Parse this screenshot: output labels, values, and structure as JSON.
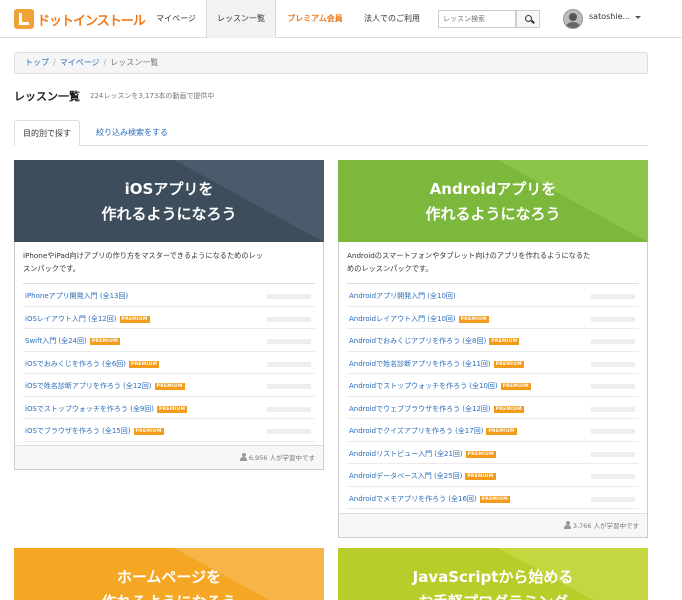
{
  "header": {
    "logo_text": "ドットインストール",
    "nav": [
      "マイページ",
      "レッスン一覧",
      "プレミアム会員",
      "法人でのご利用"
    ],
    "search_placeholder": "レッスン検索",
    "username": "satoshie..."
  },
  "breadcrumb": [
    "トップ",
    "マイページ",
    "レッスン一覧"
  ],
  "page": {
    "title": "レッスン一覧",
    "subtitle": "224レッスンを3,173本の動画で提供中"
  },
  "tabs": [
    "目的別で探す",
    "絞り込み検索をする"
  ],
  "badge_text": "PREMIUM",
  "colors": {
    "accent": "#f07a1a",
    "link": "#2a6bb8",
    "ios": "#3d4d5c",
    "android": "#7cb83b",
    "web": "#f5a623",
    "js": "#b8cc2a"
  },
  "cards": [
    {
      "title1": "iOSアプリを",
      "title2": "作れるようになろう",
      "desc1": "iPhoneやiPad向けアプリの作り方をマスターできるようになるためのレッ",
      "desc2": "スンパックです。",
      "lessons": [
        {
          "label": "iPhoneアプリ開発入門 (全13回)",
          "premium": false
        },
        {
          "label": "iOSレイアウト入門 (全12回)",
          "premium": true
        },
        {
          "label": "Swift入門 (全24回)",
          "premium": true
        },
        {
          "label": "iOSでおみくじを作ろう (全6回)",
          "premium": true
        },
        {
          "label": "iOSで姓名診断アプリを作ろう (全12回)",
          "premium": true
        },
        {
          "label": "iOSでストップウォッチを作ろう (全9回)",
          "premium": true
        },
        {
          "label": "iOSでブラウザを作ろう (全15回)",
          "premium": true
        }
      ],
      "learners": "6,956 人が学習中です"
    },
    {
      "title1": "Androidアプリを",
      "title2": "作れるようになろう",
      "desc1": "Androidのスマートフォンやタブレット向けのアプリを作れるようになるた",
      "desc2": "めのレッスンパックです。",
      "lessons": [
        {
          "label": "Androidアプリ開発入門 (全10回)",
          "premium": false
        },
        {
          "label": "Androidレイアウト入門 (全10回)",
          "premium": true
        },
        {
          "label": "Androidでおみくじアプリを作ろう (全8回)",
          "premium": true
        },
        {
          "label": "Androidで姓名診断アプリを作ろう (全11回)",
          "premium": true
        },
        {
          "label": "Androidでストップウォッチを作ろう (全10回)",
          "premium": true
        },
        {
          "label": "Androidでウェブブラウザを作ろう (全12回)",
          "premium": true
        },
        {
          "label": "Androidでクイズアプリを作ろう (全17回)",
          "premium": true
        },
        {
          "label": "Androidリストビュー入門 (全21回)",
          "premium": true
        },
        {
          "label": "Androidデータベース入門 (全25回)",
          "premium": true
        },
        {
          "label": "Androidでメモアプリを作ろう (全16回)",
          "premium": true
        }
      ],
      "learners": "3,766 人が学習中です"
    },
    {
      "title1": "ホームページを",
      "title2": "作れるようになろう"
    },
    {
      "title1": "JavaScriptから始める",
      "title2": "お手軽プログラミング"
    }
  ]
}
